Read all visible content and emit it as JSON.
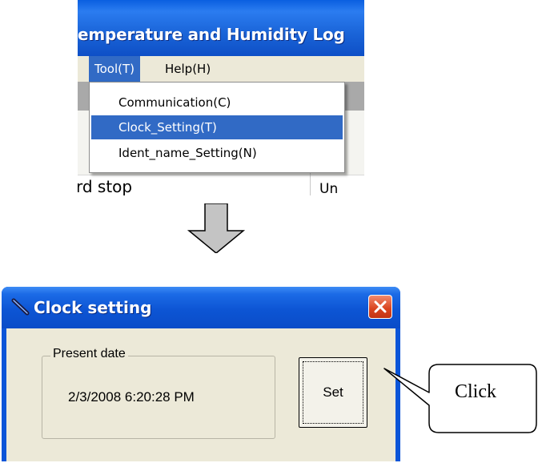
{
  "app": {
    "title_fragment": "emperature and Humidity Log",
    "menubar": [
      {
        "label": "Tool(T)",
        "active": true
      },
      {
        "label": "Help(H)",
        "active": false
      }
    ],
    "tool_menu": [
      {
        "label": "Communication(C)",
        "selected": false
      },
      {
        "label": "Clock_Setting(T)",
        "selected": true
      },
      {
        "label": "Ident_name_Setting(N)",
        "selected": false
      }
    ],
    "background_text": [
      "rd stop",
      "Un"
    ]
  },
  "arrow": {
    "direction": "down",
    "color": "#c0c0c0"
  },
  "dialog": {
    "title": "Clock setting",
    "icon": "clock-pen-icon",
    "close_icon": "close-icon",
    "group_label": "Present date",
    "date_value": "2/3/2008 6:20:28 PM",
    "set_button_label": "Set"
  },
  "callout": {
    "text": "Click"
  },
  "colors": {
    "xp_titlebar": "#0d55d4",
    "menu_highlight": "#316ac5",
    "dialog_body": "#ece9d8",
    "close_button": "#d9431e"
  }
}
